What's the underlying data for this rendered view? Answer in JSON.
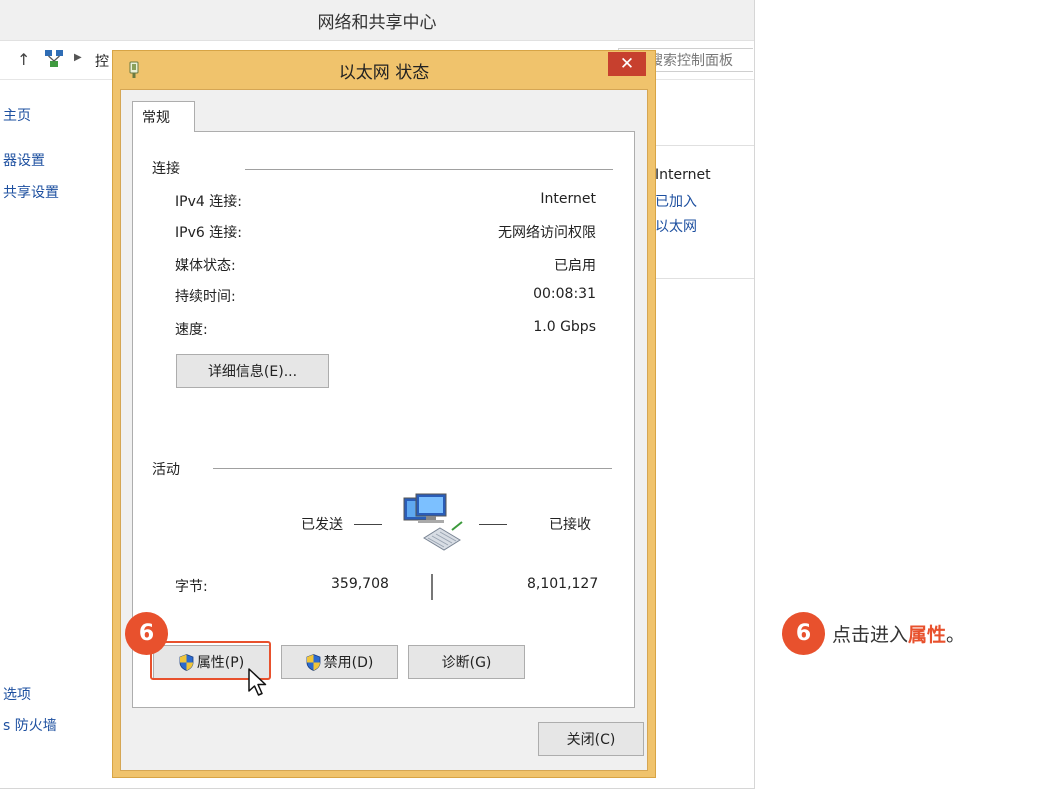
{
  "background_window": {
    "title": "网络和共享中心",
    "breadcrumb": "控",
    "search_placeholder": "搜索控制面板",
    "sidebar": [
      "主页",
      "器设置",
      "共享设置",
      "选项",
      "s 防火墙"
    ],
    "right_panel": {
      "access_type": "Internet",
      "homegroup": "已加入",
      "connection": "以太网"
    }
  },
  "dialog": {
    "title": "以太网 状态",
    "close_glyph": "✕",
    "tab_label": "常规",
    "connection_group": {
      "label": "连接",
      "rows": [
        {
          "label": "IPv4 连接:",
          "value": "Internet"
        },
        {
          "label": "IPv6 连接:",
          "value": "无网络访问权限"
        },
        {
          "label": "媒体状态:",
          "value": "已启用"
        },
        {
          "label": "持续时间:",
          "value": "00:08:31"
        },
        {
          "label": "速度:",
          "value": "1.0 Gbps"
        }
      ],
      "details_button": "详细信息(E)..."
    },
    "activity_group": {
      "label": "活动",
      "sent_label": "已发送",
      "received_label": "已接收",
      "bytes_label": "字节:",
      "bytes_sent": "359,708",
      "bytes_received": "8,101,127"
    },
    "buttons": {
      "properties": "属性(P)",
      "disable": "禁用(D)",
      "diagnose": "诊断(G)",
      "close": "关闭(C)"
    }
  },
  "step": {
    "number": "6",
    "text_before": "点击进入",
    "text_emphasis": "属性",
    "text_after": "。"
  },
  "colors": {
    "accent": "#e8512d",
    "dialog_frame": "#f0c36c",
    "link": "#1e50a0"
  }
}
